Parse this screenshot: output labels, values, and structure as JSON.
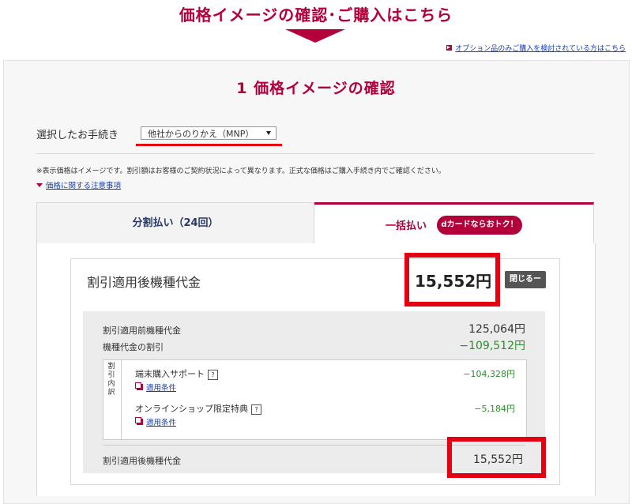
{
  "header": {
    "title": "価格イメージの確認･ご購入はこちら",
    "option_link": "オプション品のみご購入を検討されている方はこちら"
  },
  "section": {
    "title": "1 価格イメージの確認",
    "procedure_label": "選択したお手続き",
    "procedure_selected": "他社からのりかえ（MNP）",
    "note": "※表示価格はイメージです。割引額はお客様のご契約状況によって異なります。正式な価格はご購入手続き内でご確認ください。",
    "caution_link": "価格に関する注意事項"
  },
  "tabs": [
    {
      "label": "分割払い（24回）",
      "active": false
    },
    {
      "label": "一括払い",
      "active": true,
      "badge": "dカードならおトク！"
    }
  ],
  "card": {
    "title": "割引適用後機種代金",
    "price": "15,552円",
    "close_button": "閉じるー",
    "before_label": "割引適用前機種代金",
    "before_value": "125,064円",
    "discount_label": "機種代金の割引",
    "discount_value": "−109,512円",
    "breakdown_label": "割引内訳",
    "items": [
      {
        "name": "端末購入サポート",
        "help": "?",
        "link": "適用条件",
        "value": "−104,328円"
      },
      {
        "name": "オンラインショップ限定特典",
        "help": "?",
        "link": "適用条件",
        "value": "−5,184円"
      }
    ],
    "after_label": "割引適用後機種代金",
    "after_value": "15,552円"
  },
  "colors": {
    "brand": "#b3003a",
    "highlight": "#e50012",
    "discount": "#2e8b2e",
    "link": "#1a3ea8"
  }
}
